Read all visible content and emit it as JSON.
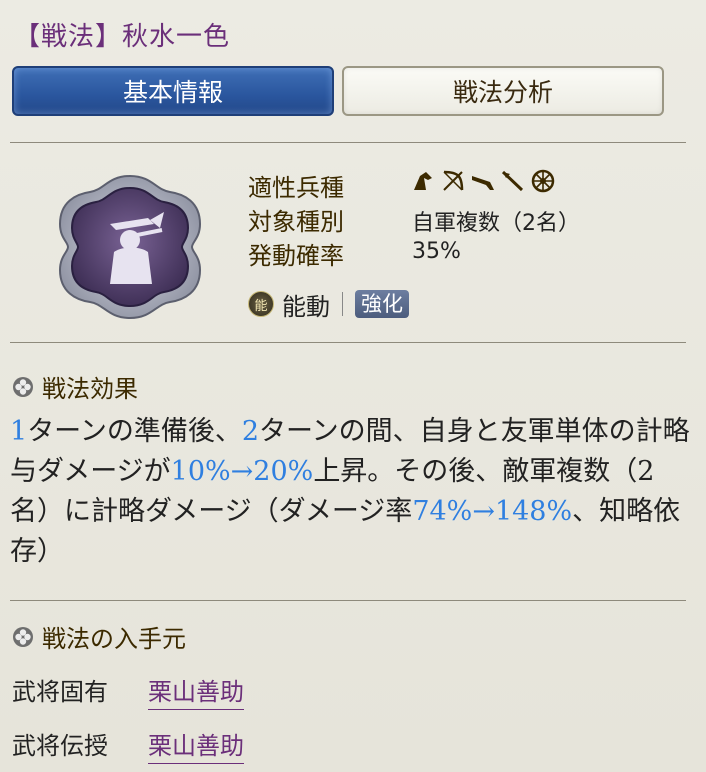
{
  "title": "【戦法】秋水一色",
  "tabs": [
    {
      "label": "基本情報",
      "active": true
    },
    {
      "label": "戦法分析",
      "active": false
    }
  ],
  "info": {
    "aptitude_label": "適性兵種",
    "aptitude_icons": [
      "cavalry-icon",
      "bow-icon",
      "gun-icon",
      "spear-icon",
      "wheel-icon"
    ],
    "target_label": "対象種別",
    "target_value": "自軍複数（2名）",
    "rate_label": "発動確率",
    "rate_value": "35%",
    "activation_badge": "能",
    "activation_type": "能動",
    "enhance_label": "強化"
  },
  "effect": {
    "heading": "戦法効果",
    "parts": [
      {
        "t": "1",
        "hl": true
      },
      {
        "t": "ターンの準備後、",
        "hl": false
      },
      {
        "t": "2",
        "hl": true
      },
      {
        "t": "ターンの間、自身と友軍単体の計略与ダメージが",
        "hl": false
      },
      {
        "t": "10%→20%",
        "hl": true
      },
      {
        "t": "上昇。その後、敵軍複数（2名）に計略ダメージ（ダメージ率",
        "hl": false
      },
      {
        "t": "74%→148%",
        "hl": true
      },
      {
        "t": "、知略依存）",
        "hl": false
      }
    ]
  },
  "source": {
    "heading": "戦法の入手元",
    "rows": [
      {
        "label": "武将固有",
        "value": "栗山善助"
      },
      {
        "label": "武将伝授",
        "value": "栗山善助"
      }
    ]
  },
  "colors": {
    "title": "#6b2f7a",
    "highlight": "#2f7fe0",
    "active_tab": "#2a569e"
  }
}
